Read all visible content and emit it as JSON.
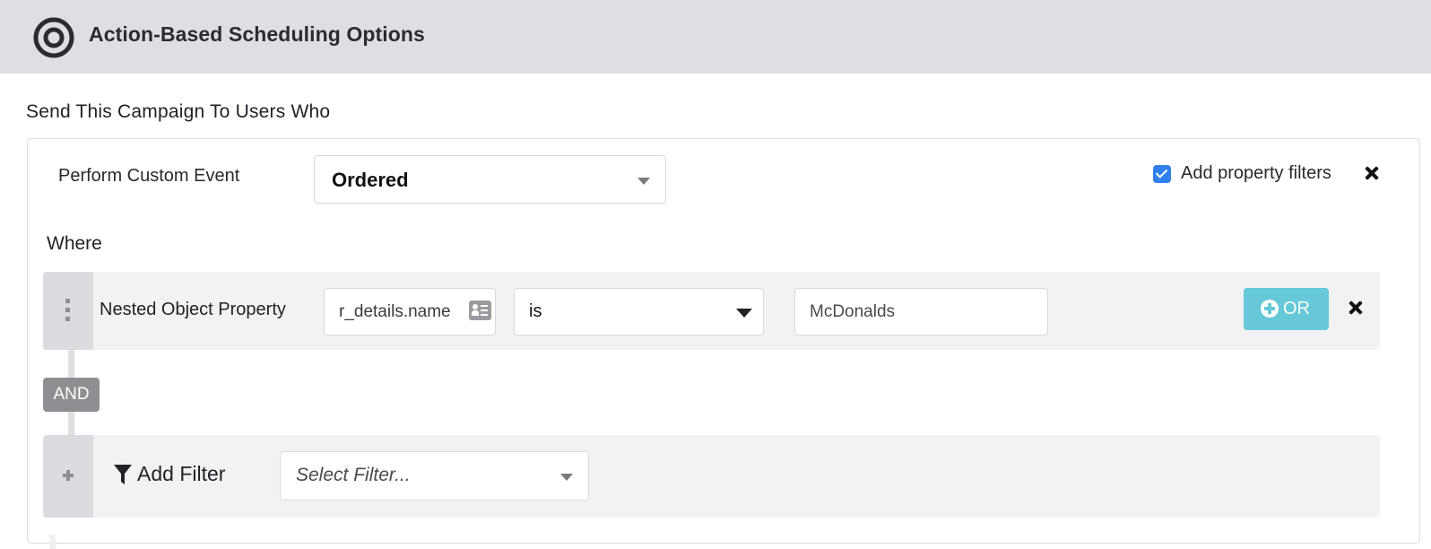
{
  "header": {
    "icon": "target-icon",
    "title": "Action-Based Scheduling Options"
  },
  "section": {
    "label": "Send This Campaign To Users Who"
  },
  "trigger": {
    "label": "Perform Custom Event",
    "selected_event": "Ordered",
    "add_property_filters": {
      "label": "Add property filters",
      "checked": true
    }
  },
  "where": {
    "label": "Where",
    "filters": [
      {
        "type_label": "Nested Object Property",
        "property_value": "r_details.name",
        "operator": "is",
        "value": "McDonalds",
        "or_button_label": "OR"
      }
    ],
    "connector_label": "AND"
  },
  "add_filter": {
    "label": "Add Filter",
    "select_placeholder": "Select Filter..."
  },
  "colors": {
    "header_bg": "#dedee3",
    "checkbox_accent": "#2f7ff0",
    "or_button": "#66c8d9",
    "and_badge": "#8e8e93",
    "row_bg": "#f2f2f4"
  }
}
